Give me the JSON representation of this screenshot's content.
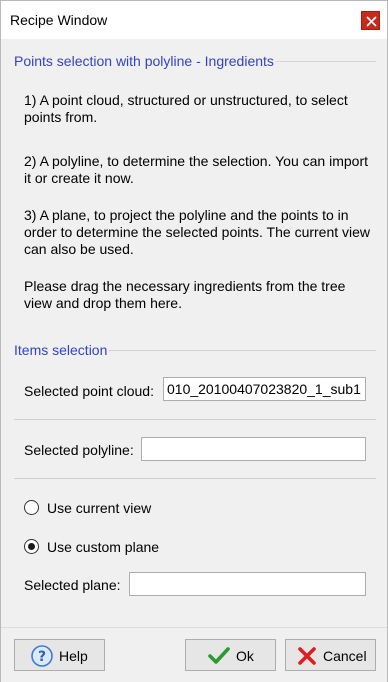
{
  "window": {
    "title": "Recipe Window"
  },
  "ingredients": {
    "group_title": "Points selection with polyline - Ingredients",
    "step1": "1) A point cloud, structured or unstructured, to select points from.",
    "step2": "2) A polyline, to determine the selection. You can import it or create it now.",
    "step3": "3) A plane, to project the polyline and the points to in order to determine the selected points. The current view can also be used.",
    "instruction": "Please drag the necessary ingredients from the tree view and drop them here."
  },
  "items": {
    "group_title": "Items selection",
    "point_cloud_label": "Selected point cloud:",
    "point_cloud_value": "010_20100407023820_1_sub1",
    "polyline_label": "Selected polyline:",
    "polyline_value": "",
    "radio_current_view": "Use current view",
    "radio_custom_plane": "Use custom plane",
    "selected_radio": "Use custom plane",
    "plane_label": "Selected plane:",
    "plane_value": ""
  },
  "buttons": {
    "help": "Help",
    "ok": "Ok",
    "cancel": "Cancel"
  },
  "icons": {
    "close": "close-icon",
    "help": "question-circle-icon",
    "ok": "checkmark-icon",
    "cancel": "x-cross-icon"
  },
  "colors": {
    "group_title": "#3343c5",
    "close_button": "#c42b1c",
    "ok_check": "#2e9a2e",
    "cancel_x": "#e01e1e",
    "help_icon": "#3a7bd5"
  }
}
